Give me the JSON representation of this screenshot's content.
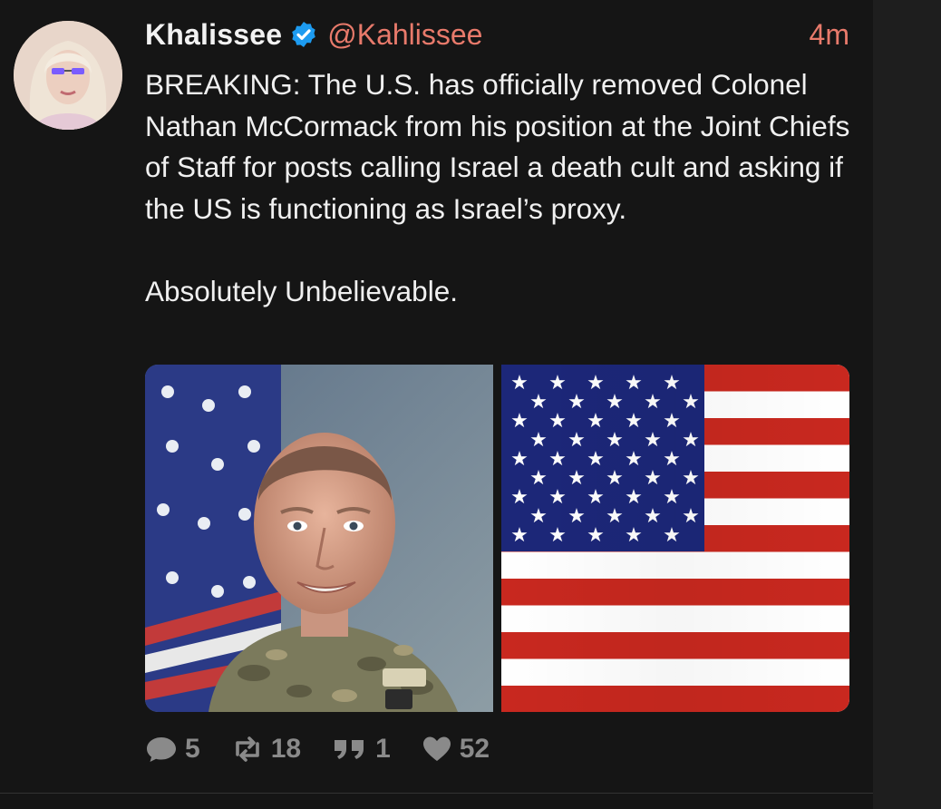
{
  "post": {
    "author": {
      "display_name": "Khalissee",
      "handle": "@Kahlissee",
      "verified": true
    },
    "timestamp": "4m",
    "text": "BREAKING: The U.S. has officially removed Colonel Nathan McCormack from his position at the Joint Chiefs of Staff for posts calling Israel a death cult and asking if the US is functioning as Israel’s proxy.\n\nAbsolutely Unbelievable.",
    "media": [
      {
        "kind": "photo",
        "subject": "soldier-portrait"
      },
      {
        "kind": "photo",
        "subject": "us-flag"
      }
    ],
    "actions": {
      "replies": "5",
      "reposts": "18",
      "quotes": "1",
      "likes": "52"
    }
  },
  "icons": {
    "verified": "verified-badge-icon",
    "reply": "speech-bubble-icon",
    "repost": "repost-arrows-icon",
    "quote": "quote-marks-icon",
    "like": "heart-icon"
  },
  "colors": {
    "background": "#151515",
    "text": "#f0f0f0",
    "accent": "#e87a6b",
    "verified": "#1d9bf0",
    "action_gray": "#8a8a8a"
  }
}
